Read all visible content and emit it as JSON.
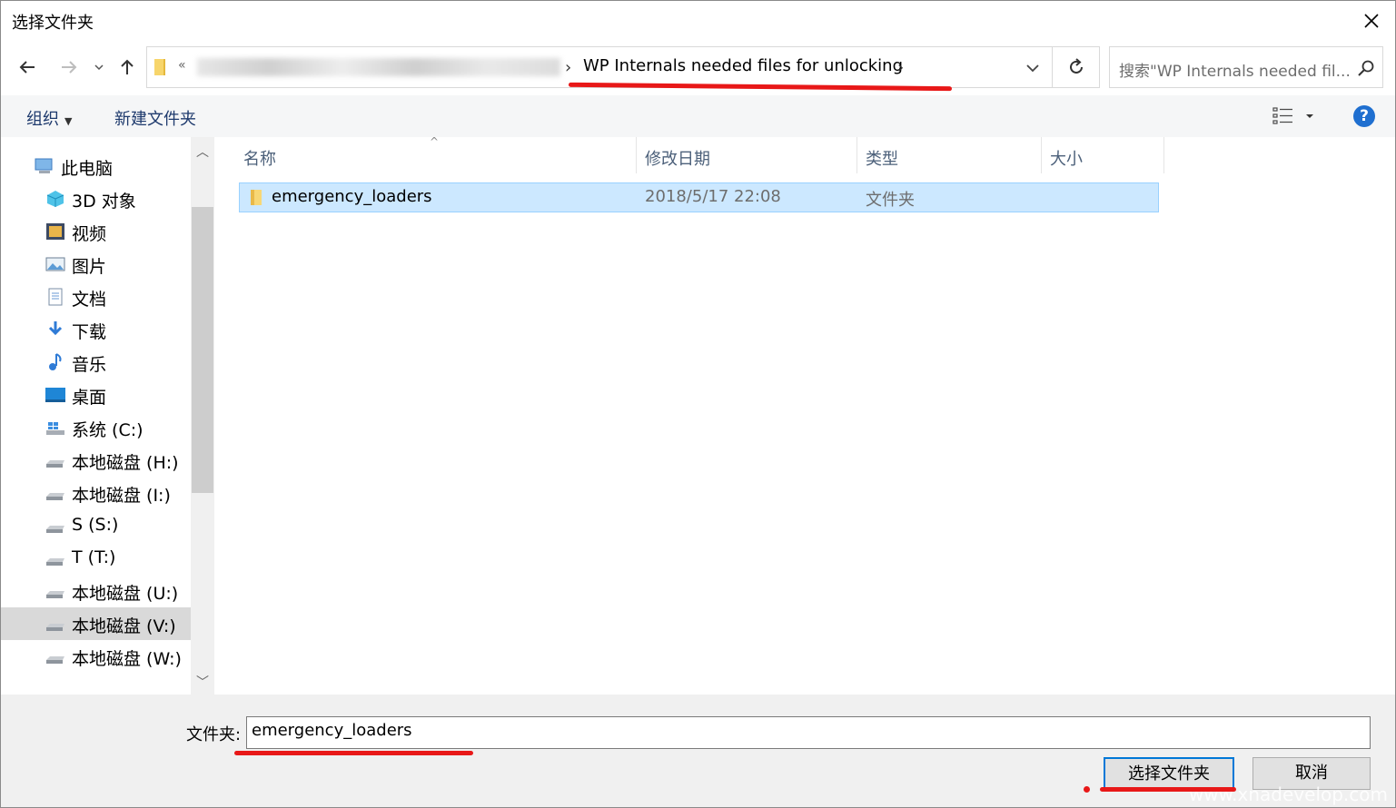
{
  "window": {
    "title": "选择文件夹"
  },
  "address_bar": {
    "prefix": "«",
    "current_folder": "WP Internals needed files for unlocking",
    "separator": "›"
  },
  "search": {
    "placeholder": "搜索\"WP Internals needed fil..."
  },
  "toolbar": {
    "organize": "组织",
    "new_folder": "新建文件夹",
    "help": "?"
  },
  "nav_pane": {
    "items": [
      {
        "label": "此电脑",
        "icon": "computer-icon"
      },
      {
        "label": "3D 对象",
        "icon": "3d-objects-icon"
      },
      {
        "label": "视频",
        "icon": "video-icon"
      },
      {
        "label": "图片",
        "icon": "pictures-icon"
      },
      {
        "label": "文档",
        "icon": "documents-icon"
      },
      {
        "label": "下载",
        "icon": "downloads-icon"
      },
      {
        "label": "音乐",
        "icon": "music-icon"
      },
      {
        "label": "桌面",
        "icon": "desktop-icon"
      },
      {
        "label": "系统 (C:)",
        "icon": "system-drive-icon"
      },
      {
        "label": "本地磁盘 (H:)",
        "icon": "drive-icon"
      },
      {
        "label": "本地磁盘 (I:)",
        "icon": "drive-icon"
      },
      {
        "label": "S (S:)",
        "icon": "drive-icon"
      },
      {
        "label": "T (T:)",
        "icon": "drive-icon"
      },
      {
        "label": "本地磁盘 (U:)",
        "icon": "drive-icon"
      },
      {
        "label": "本地磁盘 (V:)",
        "icon": "drive-icon",
        "selected": true
      },
      {
        "label": "本地磁盘 (W:)",
        "icon": "drive-icon"
      }
    ]
  },
  "file_list": {
    "columns": [
      "名称",
      "修改日期",
      "类型",
      "大小"
    ],
    "rows": [
      {
        "name": "emergency_loaders",
        "modified": "2018/5/17 22:08",
        "type": "文件夹",
        "size": ""
      }
    ]
  },
  "footer": {
    "folder_label": "文件夹:",
    "folder_value": "emergency_loaders",
    "select_button": "选择文件夹",
    "cancel_button": "取消"
  },
  "watermark": "www.xnadevelop.com",
  "colors": {
    "selection": "#cce8ff",
    "selection_border": "#99d1ff",
    "accent": "#0078d7",
    "annotation": "#e81818"
  }
}
